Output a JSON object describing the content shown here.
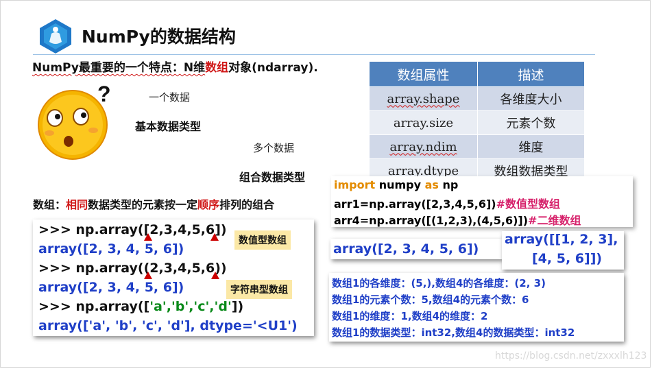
{
  "title": "NumPy的数据结构",
  "subtitle": {
    "pre": "NumPy最重要的一个特点：N维",
    "highlight": "数组",
    "post": "对象(ndarray)."
  },
  "attr_table": {
    "headers": [
      "数组属性",
      "描述"
    ],
    "rows": [
      [
        "array.shape",
        "各维度大小"
      ],
      [
        "array.size",
        "元素个数"
      ],
      [
        "array.ndim",
        "维度"
      ],
      [
        "array.dtype",
        "数组数据类型"
      ]
    ]
  },
  "concepts": {
    "single_data": "一个数据",
    "basic_type": "基本数据类型",
    "multi_data": "多个数据",
    "compound_type": "组合数据类型"
  },
  "definition": {
    "p1": "数组：",
    "r1": "相同",
    "p2": "数据类型的元素按一定",
    "r2": "顺序",
    "p3": "排列的组合"
  },
  "left_code": {
    "l1": ">>> np.array([2,3,4,5,6])",
    "l2": "array([2, 3, 4, 5, 6])",
    "l3": ">>> np.array((2,3,4,5,6))",
    "l4": "array([2, 3, 4, 5, 6])",
    "l5_pre": ">>> np.array([",
    "l5_str": "'a','b','c','d'",
    "l5_post": "])",
    "l6": "array(['a', 'b', 'c', 'd'], dtype='<U1')",
    "tag_numeric": "数值型数组",
    "tag_string": "字符串型数组"
  },
  "right_code": {
    "import_kw": "import",
    "import_mod": " numpy ",
    "as_kw": "as",
    "alias": " np",
    "arr1_code": "arr1=np.array([2,3,4,5,6])",
    "arr1_comment": "#数值型数组",
    "arr4_code": "arr4=np.array([(1,2,3),(4,5,6)])",
    "arr4_comment": "#二维数组",
    "result1": "array([2, 3, 4, 5, 6])",
    "result2_l1": "array([[1, 2, 3],",
    "result2_l2": "[4, 5, 6]])"
  },
  "info_lines": [
    "数组1的各维度：(5,),数组4的各维度：(2, 3)",
    "数组1的元素个数：5,数组4的元素个数：6",
    "数组1的维度：1,数组4的维度：2",
    "数组1的数据类型：int32,数组4的数据类型：int32"
  ],
  "watermark": "https://blog.csdn.net/zxxxlh123",
  "colors": {
    "accent_blue": "#4f81bd",
    "highlight_red": "#d01818",
    "output_blue": "#1f3fc7",
    "tag_yellow": "#fbe8a6"
  }
}
